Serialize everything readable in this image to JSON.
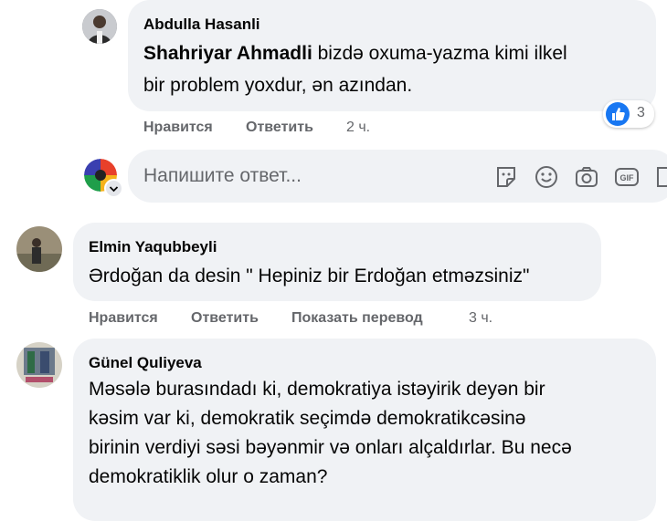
{
  "comments": [
    {
      "author": "Abdulla Hasanli",
      "mention": "Shahriyar Ahmadli",
      "text_line1": " bizdə oxuma-yazma kimi ilkel",
      "text_line2": "bir problem yoxdur, ən azından.",
      "reaction_count": "3",
      "time": "2 ч."
    },
    {
      "author": "Elmin Yaqubbeyli",
      "text": "Ərdoğan da desin \" Hepiniz bir Erdoğan etməzsiniz\"",
      "time": "3 ч."
    },
    {
      "author": "Günel Quliyeva",
      "lines": [
        "Məsələ burasındadı ki, demokratiya istəyirik deyən bir",
        "kəsim var ki, demokratik seçimdə demokratikcəsinə",
        "birinin verdiyi səsi bəyənmir və onları alçaldırlar. Bu necə",
        "demokratiklik olur o zaman?"
      ]
    }
  ],
  "actions": {
    "like": "Нравится",
    "reply": "Ответить",
    "translate": "Показать перевод"
  },
  "reply_box": {
    "placeholder": "Напишите ответ..."
  },
  "colors": {
    "bubble": "#f0f2f5",
    "meta": "#65676b",
    "like_blue": "#1877f2"
  },
  "icons": [
    "thumbs-up-icon",
    "sticker-icon",
    "emoji-icon",
    "camera-icon",
    "gif-icon"
  ]
}
